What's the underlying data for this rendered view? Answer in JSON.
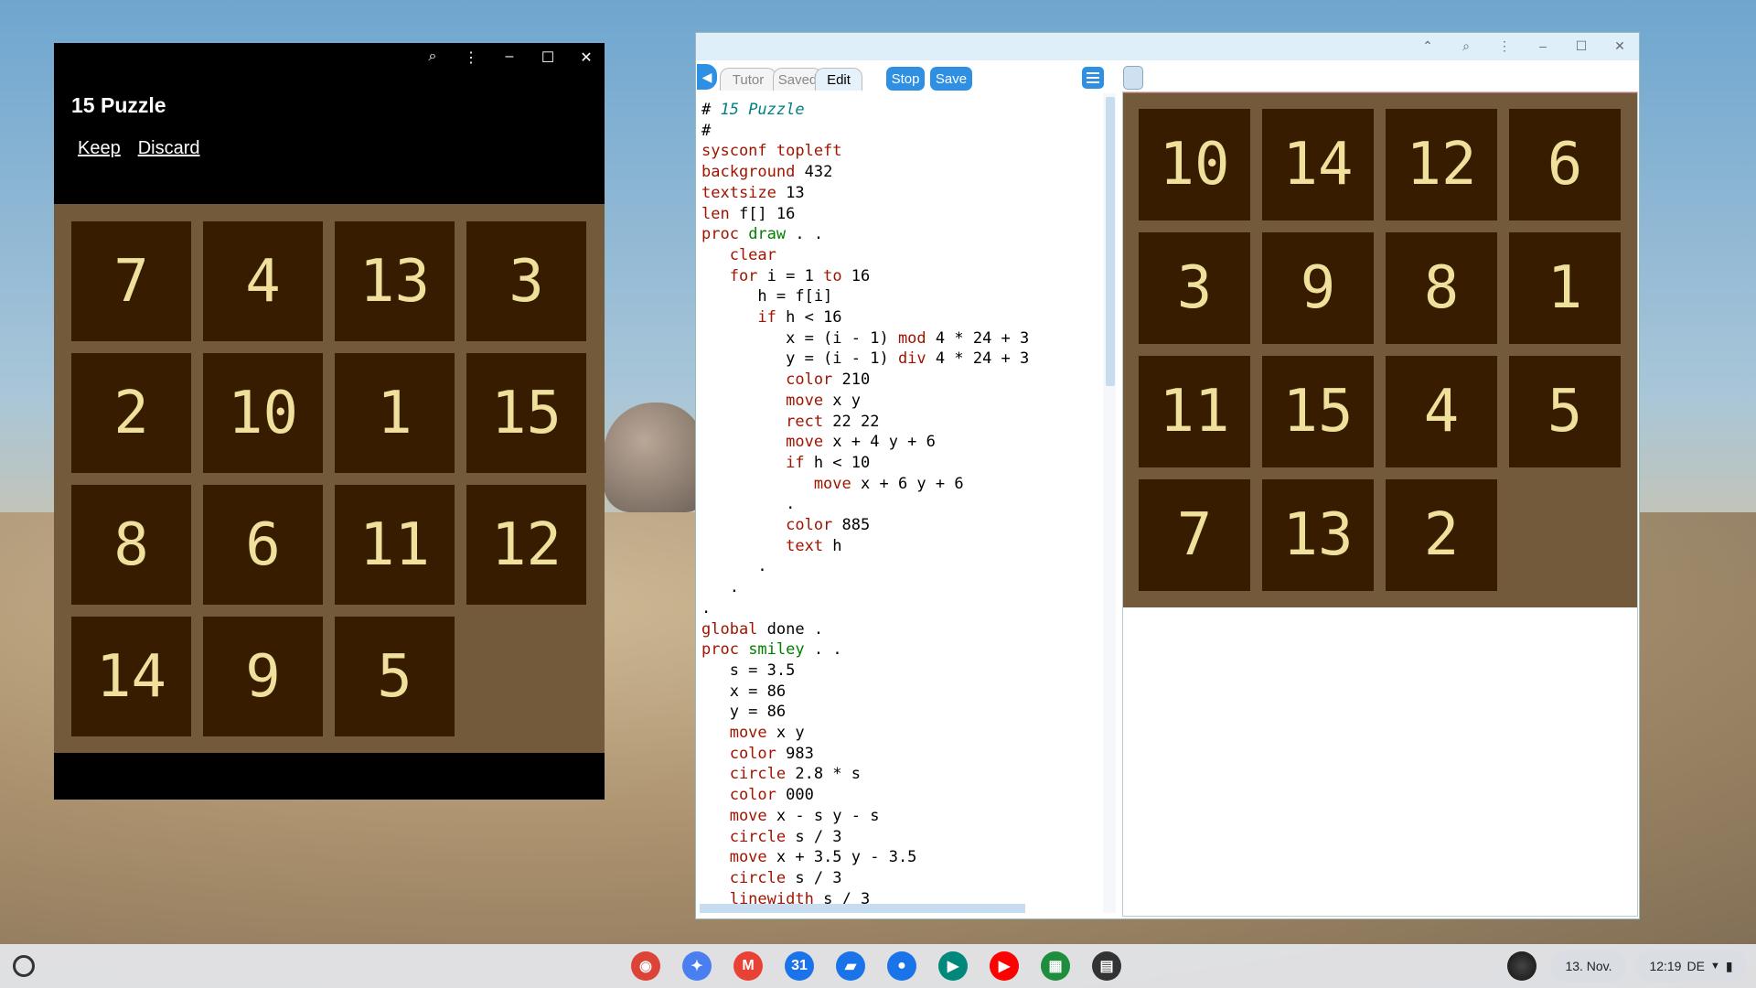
{
  "left_window": {
    "title": "15 Puzzle",
    "controls": {
      "zoom": "⌕",
      "more": "⋮",
      "minimize": "–",
      "maximize": "☐",
      "close": "✕"
    },
    "keep_label": "Keep",
    "discard_label": "Discard",
    "tiles": [
      "7",
      "4",
      "13",
      "3",
      "2",
      "10",
      "1",
      "15",
      "8",
      "6",
      "11",
      "12",
      "14",
      "9",
      "5",
      ""
    ]
  },
  "right_window": {
    "controls": {
      "collapse": "⌃",
      "zoom": "⌕",
      "more": "⋮",
      "minimize": "–",
      "maximize": "☐",
      "close": "✕"
    },
    "back_icon": "◀",
    "tabs": {
      "tutor": "Tutor",
      "saved": "Saved",
      "edit": "Edit"
    },
    "stop_label": "Stop",
    "save_label": "Save",
    "code": [
      [
        {
          "t": "# ",
          "c": "#000"
        },
        {
          "t": "15 Puzzle",
          "c": "#008080",
          "i": true
        }
      ],
      [
        {
          "t": "#",
          "c": "#000"
        }
      ],
      [
        {
          "t": "sysconf topleft",
          "c": "#a01400"
        }
      ],
      [
        {
          "t": "background",
          "c": "#a01400"
        },
        {
          "t": " 432",
          "c": "#000"
        }
      ],
      [
        {
          "t": "textsize",
          "c": "#a01400"
        },
        {
          "t": " 13",
          "c": "#000"
        }
      ],
      [
        {
          "t": "len",
          "c": "#a01400"
        },
        {
          "t": " f[] 16",
          "c": "#000"
        }
      ],
      [
        {
          "t": "proc",
          "c": "#a01400"
        },
        {
          "t": " draw",
          "c": "#008000"
        },
        {
          "t": " . .",
          "c": "#000"
        }
      ],
      [
        {
          "t": "   clear",
          "c": "#a01400"
        }
      ],
      [
        {
          "t": "   for",
          "c": "#a01400"
        },
        {
          "t": " i = 1 ",
          "c": "#000"
        },
        {
          "t": "to",
          "c": "#a01400"
        },
        {
          "t": " 16",
          "c": "#000"
        }
      ],
      [
        {
          "t": "      h = f[i]",
          "c": "#000"
        }
      ],
      [
        {
          "t": "      if",
          "c": "#a01400"
        },
        {
          "t": " h < 16",
          "c": "#000"
        }
      ],
      [
        {
          "t": "         x = (i - 1) ",
          "c": "#000"
        },
        {
          "t": "mod",
          "c": "#a01400"
        },
        {
          "t": " 4 * 24 + 3",
          "c": "#000"
        }
      ],
      [
        {
          "t": "         y = (i - 1) ",
          "c": "#000"
        },
        {
          "t": "div",
          "c": "#a01400"
        },
        {
          "t": " 4 * 24 + 3",
          "c": "#000"
        }
      ],
      [
        {
          "t": "         color",
          "c": "#a01400"
        },
        {
          "t": " 210",
          "c": "#000"
        }
      ],
      [
        {
          "t": "         move",
          "c": "#a01400"
        },
        {
          "t": " x y",
          "c": "#000"
        }
      ],
      [
        {
          "t": "         rect",
          "c": "#a01400"
        },
        {
          "t": " 22 22",
          "c": "#000"
        }
      ],
      [
        {
          "t": "         move",
          "c": "#a01400"
        },
        {
          "t": " x + 4 y + 6",
          "c": "#000"
        }
      ],
      [
        {
          "t": "         if",
          "c": "#a01400"
        },
        {
          "t": " h < 10",
          "c": "#000"
        }
      ],
      [
        {
          "t": "            move",
          "c": "#a01400"
        },
        {
          "t": " x + 6 y + 6",
          "c": "#000"
        }
      ],
      [
        {
          "t": "         .",
          "c": "#000"
        }
      ],
      [
        {
          "t": "         color",
          "c": "#a01400"
        },
        {
          "t": " 885",
          "c": "#000"
        }
      ],
      [
        {
          "t": "         text",
          "c": "#a01400"
        },
        {
          "t": " h",
          "c": "#000"
        }
      ],
      [
        {
          "t": "      .",
          "c": "#000"
        }
      ],
      [
        {
          "t": "   .",
          "c": "#000"
        }
      ],
      [
        {
          "t": ".",
          "c": "#000"
        }
      ],
      [
        {
          "t": "global",
          "c": "#a01400"
        },
        {
          "t": " done .",
          "c": "#000"
        }
      ],
      [
        {
          "t": "proc",
          "c": "#a01400"
        },
        {
          "t": " smiley",
          "c": "#008000"
        },
        {
          "t": " . .",
          "c": "#000"
        }
      ],
      [
        {
          "t": "   s = 3.5",
          "c": "#000"
        }
      ],
      [
        {
          "t": "   x = 86",
          "c": "#000"
        }
      ],
      [
        {
          "t": "   y = 86",
          "c": "#000"
        }
      ],
      [
        {
          "t": "   move",
          "c": "#a01400"
        },
        {
          "t": " x y",
          "c": "#000"
        }
      ],
      [
        {
          "t": "   color",
          "c": "#a01400"
        },
        {
          "t": " 983",
          "c": "#000"
        }
      ],
      [
        {
          "t": "   circle",
          "c": "#a01400"
        },
        {
          "t": " 2.8 * s",
          "c": "#000"
        }
      ],
      [
        {
          "t": "   color",
          "c": "#a01400"
        },
        {
          "t": " 000",
          "c": "#000"
        }
      ],
      [
        {
          "t": "   move",
          "c": "#a01400"
        },
        {
          "t": " x - s y - s",
          "c": "#000"
        }
      ],
      [
        {
          "t": "   circle",
          "c": "#a01400"
        },
        {
          "t": " s / 3",
          "c": "#000"
        }
      ],
      [
        {
          "t": "   move",
          "c": "#a01400"
        },
        {
          "t": " x + 3.5 y - 3.5",
          "c": "#000"
        }
      ],
      [
        {
          "t": "   circle",
          "c": "#a01400"
        },
        {
          "t": " s / 3",
          "c": "#000"
        }
      ],
      [
        {
          "t": "   linewidth",
          "c": "#a01400"
        },
        {
          "t": " s / 3",
          "c": "#000"
        }
      ]
    ],
    "graphics_tiles": [
      "10",
      "14",
      "12",
      "6",
      "3",
      "9",
      "8",
      "1",
      "11",
      "15",
      "4",
      "5",
      "7",
      "13",
      "2",
      ""
    ]
  },
  "shelf": {
    "apps": [
      {
        "name": "chrome-icon",
        "glyph": "◉",
        "color": "#db4437"
      },
      {
        "name": "gemini-icon",
        "glyph": "✦",
        "color": "#4a7ff0"
      },
      {
        "name": "gmail-icon",
        "glyph": "M",
        "color": "#e94235"
      },
      {
        "name": "calendar-icon",
        "glyph": "31",
        "color": "#1a73e8"
      },
      {
        "name": "files-icon",
        "glyph": "▰",
        "color": "#1a73e8"
      },
      {
        "name": "messages-icon",
        "glyph": "●",
        "color": "#1a73e8"
      },
      {
        "name": "meet-icon",
        "glyph": "▶",
        "color": "#00897b"
      },
      {
        "name": "youtube-icon",
        "glyph": "▶",
        "color": "#ff0000"
      },
      {
        "name": "puzzle-app-icon",
        "glyph": "▦",
        "color": "#1e8e3e"
      },
      {
        "name": "editor-app-icon",
        "glyph": "▤",
        "color": "#333333"
      }
    ],
    "date": "13. Nov.",
    "time": "12:19",
    "locale": "DE",
    "wifi_icon": "▼",
    "battery_icon": "▮"
  },
  "colors": {
    "board_bg": "#735a3b",
    "tile_bg": "#381c00",
    "tile_text": "#efe19c",
    "accent": "#2f8fe3"
  }
}
